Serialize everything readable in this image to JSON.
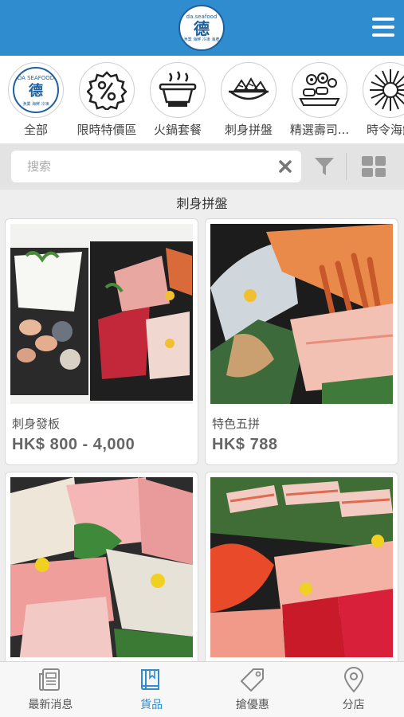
{
  "header": {
    "logo_arc": "da.seafood",
    "logo_mark": "德",
    "logo_sub": "漁業 海鮮 冷凍 海產"
  },
  "categories": [
    {
      "label": "全部",
      "icon": "brand-logo-icon",
      "logo_text": "DA SEAFOOD"
    },
    {
      "label": "限時特價區",
      "icon": "percent-badge-icon"
    },
    {
      "label": "火鍋套餐",
      "icon": "hotpot-icon"
    },
    {
      "label": "刺身拼盤",
      "icon": "sashimi-platter-icon"
    },
    {
      "label": "精選壽司...",
      "icon": "sushi-icon"
    },
    {
      "label": "時令海鮮",
      "icon": "sea-urchin-icon"
    }
  ],
  "search": {
    "placeholder": "搜索"
  },
  "section": {
    "title": "刺身拼盤"
  },
  "products": [
    {
      "name": "刺身發板",
      "price": "HK$ 800 - 4,000"
    },
    {
      "name": "特色五拼",
      "price": "HK$ 788"
    },
    {
      "name": "",
      "price": ""
    },
    {
      "name": "",
      "price": ""
    }
  ],
  "tabs": [
    {
      "label": "最新消息",
      "icon": "newspaper-icon"
    },
    {
      "label": "貨品",
      "icon": "book-icon",
      "active": true
    },
    {
      "label": "搶優惠",
      "icon": "price-tag-icon"
    },
    {
      "label": "分店",
      "icon": "map-pin-icon"
    }
  ],
  "colors": {
    "accent": "#2f8ccf",
    "header": "#2f8ccf",
    "price": "#666666"
  }
}
